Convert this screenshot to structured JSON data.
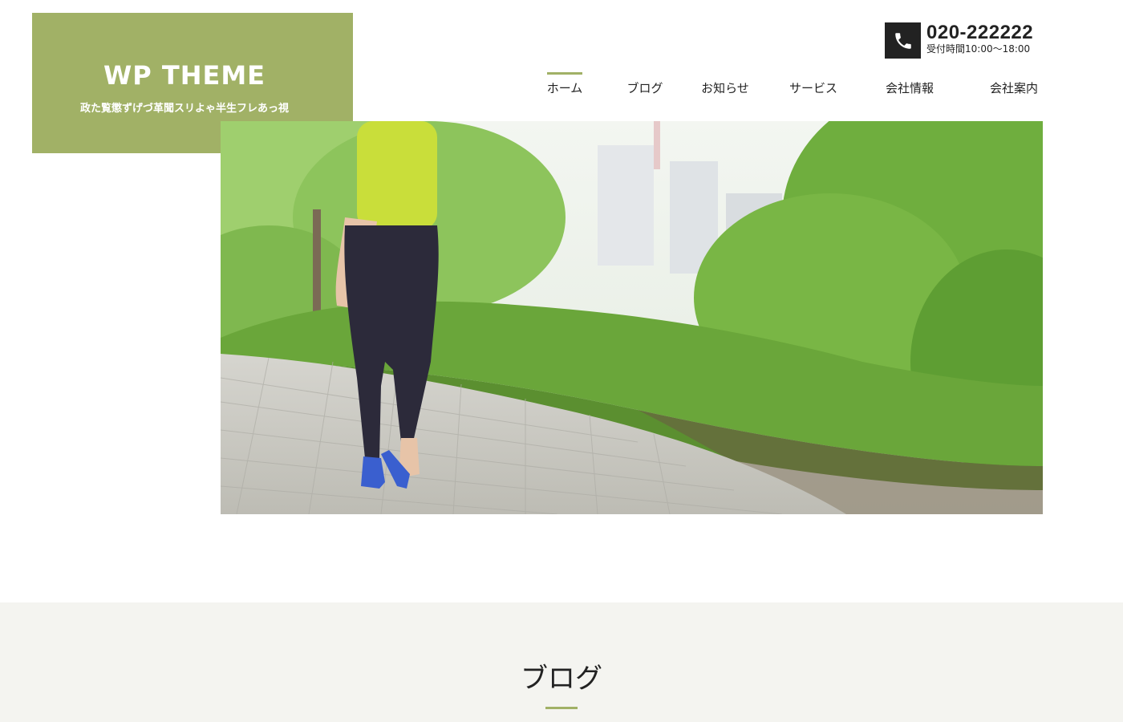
{
  "header": {
    "logo_title": "WP THEME",
    "logo_tagline": "政た覧懲ずげづ革聞スリよゃ半生フレあっ視",
    "phone_number": "020-222222",
    "phone_hours": "受付時間10:00〜18:00"
  },
  "nav": {
    "items": [
      {
        "label": "ホーム",
        "active": true
      },
      {
        "label": "ブログ",
        "active": false
      },
      {
        "label": "お知らせ",
        "active": false
      },
      {
        "label": "サービス",
        "active": false
      },
      {
        "label": "会社情報",
        "active": false
      },
      {
        "label": "会社案内",
        "active": false
      }
    ]
  },
  "hero": {
    "icon": "hero-photo"
  },
  "section": {
    "title": "ブログ"
  },
  "colors": {
    "accent": "#a1b166",
    "dark": "#222222",
    "band": "#f4f4f0"
  }
}
